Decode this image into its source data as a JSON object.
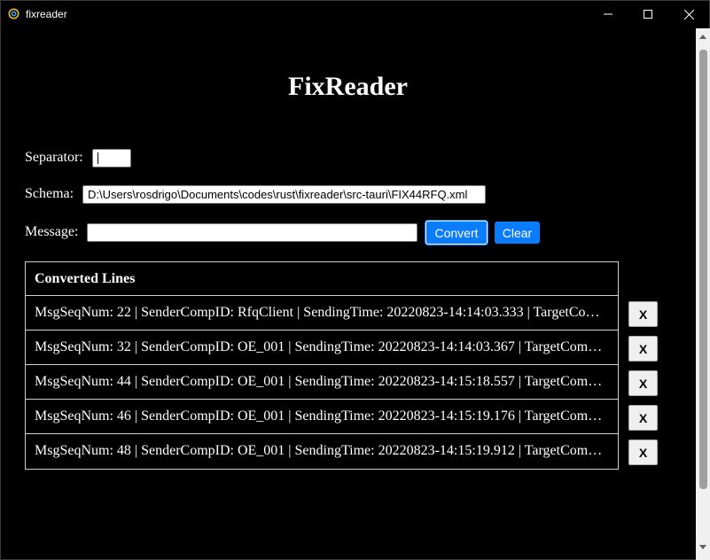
{
  "window": {
    "title": "fixreader"
  },
  "app": {
    "heading": "FixReader",
    "separator_label": "Separator:",
    "separator_value": "",
    "schema_label": "Schema:",
    "schema_value": "D:\\Users\\rosdrigo\\Documents\\codes\\rust\\fixreader\\src-tauri\\FIX44RFQ.xml",
    "message_label": "Message:",
    "message_value": "",
    "convert_label": "Convert",
    "clear_label": "Clear",
    "table_header": "Converted Lines",
    "remove_label": "X",
    "rows": [
      "MsgSeqNum: 22 | SenderCompID: RfqClient | SendingTime: 20220823-14:14:03.333 | TargetCo…",
      "MsgSeqNum: 32 | SenderCompID: OE_001 | SendingTime: 20220823-14:14:03.367 | TargetCom…",
      "MsgSeqNum: 44 | SenderCompID: OE_001 | SendingTime: 20220823-14:15:18.557 | TargetCom…",
      "MsgSeqNum: 46 | SenderCompID: OE_001 | SendingTime: 20220823-14:15:19.176 | TargetCom…",
      "MsgSeqNum: 48 | SenderCompID: OE_001 | SendingTime: 20220823-14:15:19.912 | TargetCom…"
    ]
  },
  "colors": {
    "accent": "#0a7cff",
    "background": "#000000",
    "text": "#ffffff"
  }
}
